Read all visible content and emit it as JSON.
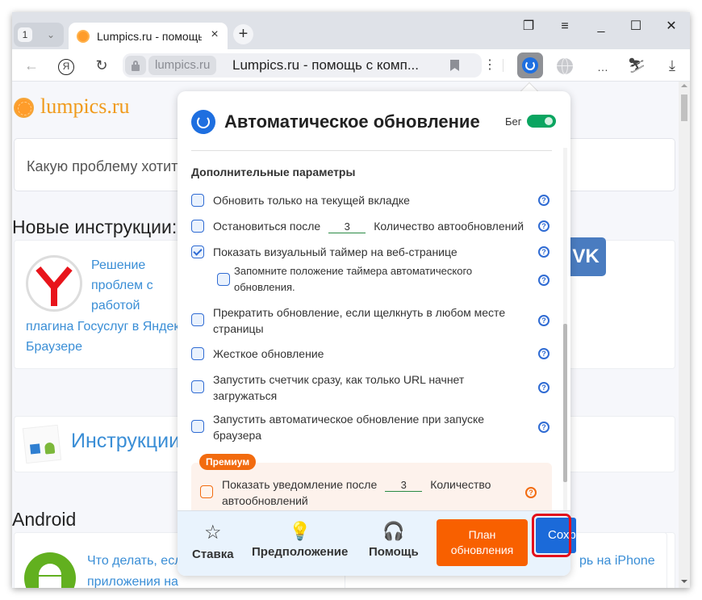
{
  "browser": {
    "tab_count": "1",
    "tab_title": "Lumpics.ru - помощь с компьютером",
    "omnibox_domain": "lumpics.ru",
    "omnibox_title": "Lumpics.ru - помощь с комп...",
    "window_controls": [
      "bookmarks-panel-icon",
      "menu-icon",
      "minimize-icon",
      "maximize-icon",
      "close-icon"
    ],
    "toolbar_icons": [
      "back-icon",
      "yandex-icon",
      "reload-icon",
      "lock-icon",
      "bookmark-icon",
      "more-icon",
      "auto-refresh-extension-icon",
      "globe-icon",
      "ellipsis-icon",
      "profile-icon",
      "download-icon"
    ]
  },
  "page": {
    "site_name": "lumpics.ru",
    "search_placeholder": "Какую проблему хотите решить?",
    "section_new": "Новые инструкции:",
    "new_article_title": "Решение проблем с работой плагина Госуслуг в Яндекс Браузере",
    "new_article_lines": [
      "Решение",
      "проблем с",
      "работой",
      "плагина Госуслуг в Яндекс",
      "Браузере"
    ],
    "instructions_heading": "Инструкции",
    "section_android": "Android",
    "android_article_lines": [
      "Что делать, если",
      "приложения на"
    ],
    "iphone_article_fragment": "рь на iPhone",
    "vk_label": "VK"
  },
  "popup": {
    "title": "Автоматическое обновление",
    "run_label": "Бег",
    "run_enabled": true,
    "section_title": "Дополнительные параметры",
    "options": [
      {
        "label": "Обновить только на текущей вкладке",
        "checked": false
      },
      {
        "label_before": "Остановиться после",
        "value": "3",
        "label_after": "Количество автообновлений",
        "checked": false
      },
      {
        "label": "Показать визуальный таймер на веб-странице",
        "checked": true
      },
      {
        "label_line1": "Запомните положение таймера автоматического",
        "label_line2": "обновления.",
        "checked": false
      },
      {
        "label_line1": "Прекратить обновление, если щелкнуть в любом месте",
        "label_line2": "страницы",
        "checked": false
      },
      {
        "label": "Жесткое обновление",
        "checked": false
      },
      {
        "label_line1": "Запустить счетчик сразу, как только URL начнет",
        "label_line2": "загружаться",
        "checked": false
      },
      {
        "label_line1": "Запустить автоматическое обновление при запуске",
        "label_line2": "браузера",
        "checked": false
      }
    ],
    "premium": {
      "badge": "Премиум",
      "label_before": "Показать уведомление после",
      "value": "3",
      "label_after": "Количество",
      "label_line2": "автообновлений",
      "checked": false
    },
    "help_glyph": "?",
    "footer": {
      "rate_label": "Ставка",
      "suggest_label": "Предположение",
      "help_label": "Помощь",
      "plan_line1": "План",
      "plan_line2": "обновления",
      "save_label": "Сохранить"
    }
  }
}
